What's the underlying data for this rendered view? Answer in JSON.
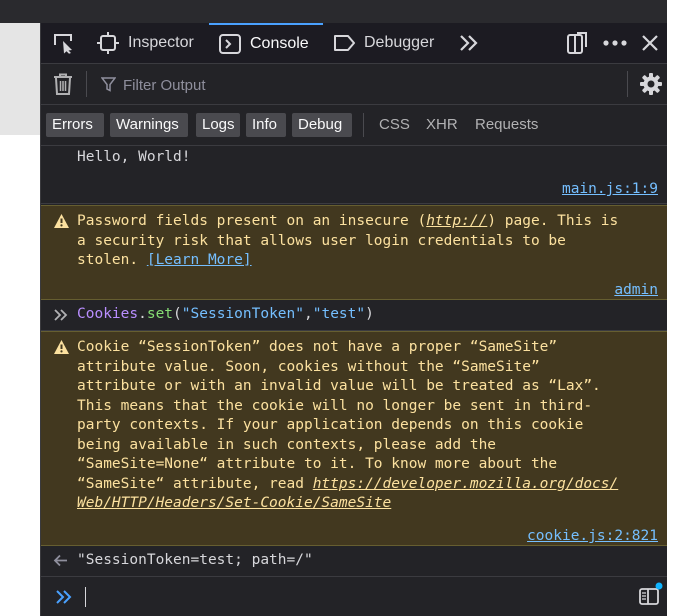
{
  "toolbar": {
    "tabs": [
      {
        "label": "Inspector",
        "icon": "inspector-icon"
      },
      {
        "label": "Console",
        "icon": "console-icon",
        "active": true
      },
      {
        "label": "Debugger",
        "icon": "debugger-icon"
      }
    ],
    "accent": "#4aa1ff"
  },
  "filter": {
    "placeholder": "Filter Output"
  },
  "categories": {
    "levels": [
      "Errors",
      "Warnings",
      "Logs",
      "Info",
      "Debug"
    ],
    "requests": [
      "CSS",
      "XHR",
      "Requests"
    ]
  },
  "messages": {
    "log": {
      "text": "Hello, World!",
      "location": "main.js:1:9"
    },
    "password_warning": {
      "line1_pre": "Password fields present on an insecure (",
      "line1_link": "http://",
      "line1_post": ") page. This is",
      "line2": "a security risk that allows user login credentials to be",
      "line3_pre": "stolen. ",
      "learn_more": "[Learn More]",
      "location": "admin"
    },
    "command": {
      "obj": "Cookies",
      "dot": ".",
      "method": "set",
      "open": "(",
      "arg1": "\"SessionToken\"",
      "comma": ",",
      "arg2": "\"test\"",
      "close": ")"
    },
    "cookie_warning": {
      "lines": [
        "Cookie “SessionToken” does not have a proper “SameSite”",
        "attribute value. Soon, cookies without the “SameSite”",
        "attribute or with an invalid value will be treated as “Lax”.",
        "This means that the cookie will no longer be sent in third-",
        "party contexts. If your application depends on this cookie",
        "being available in such contexts, please add the",
        "“SameSite=None“ attribute to it. To know more about the"
      ],
      "line8_pre": "“SameSite“ attribute, read ",
      "link_part1": "https://developer.mozilla.org/docs/",
      "link_part2": "Web/HTTP/Headers/Set-Cookie/SameSite",
      "location": "cookie.js:2:821"
    },
    "result": {
      "text": "\"SessionToken=test; path=/\""
    }
  }
}
